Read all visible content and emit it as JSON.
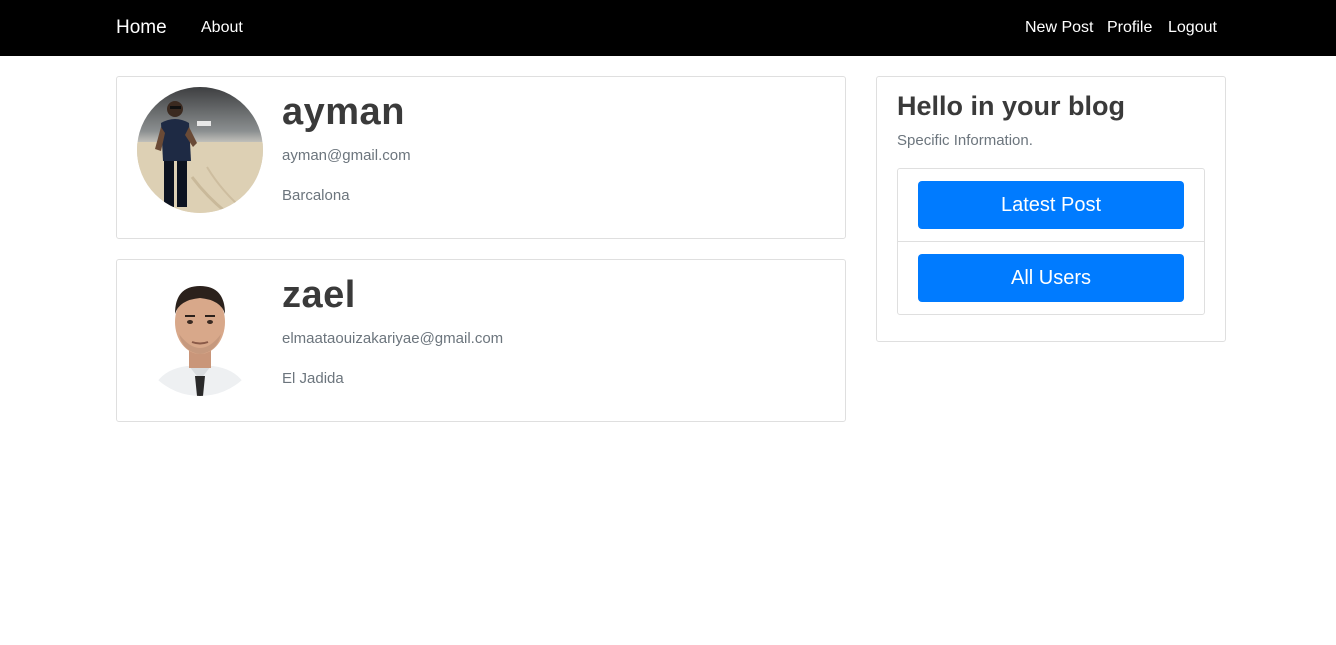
{
  "navbar": {
    "brand": "Home",
    "left_links": [
      "About"
    ],
    "right_links": [
      "New Post",
      "Profile",
      "Logout"
    ]
  },
  "users": [
    {
      "name": "ayman",
      "email": "ayman@gmail.com",
      "city": "Barcalona"
    },
    {
      "name": "zael",
      "email": "elmaataouizakariyae@gmail.com",
      "city": "El Jadida"
    }
  ],
  "sidebar": {
    "title": "Hello in your blog",
    "subtitle": "Specific Information.",
    "buttons": [
      "Latest Post",
      "All Users"
    ]
  },
  "colors": {
    "navbar_bg": "#000000",
    "primary_button": "#007bff",
    "muted_text": "#6c757d"
  }
}
